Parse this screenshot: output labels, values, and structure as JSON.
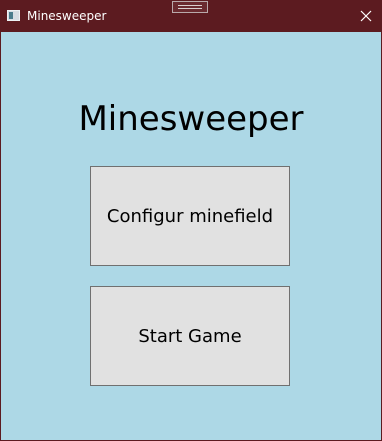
{
  "window": {
    "title": "Minesweeper",
    "titlebar_color": "#5c1b20",
    "background_color": "#add8e6",
    "icons": {
      "app": "app-window-icon",
      "close": "close-icon",
      "drag": "drag-handle-icon"
    }
  },
  "main": {
    "heading": "Minesweeper",
    "buttons": {
      "configure_label": "Configur minefield",
      "start_label": "Start Game",
      "face_color": "#e1e1e1",
      "border_color": "#707070"
    }
  }
}
